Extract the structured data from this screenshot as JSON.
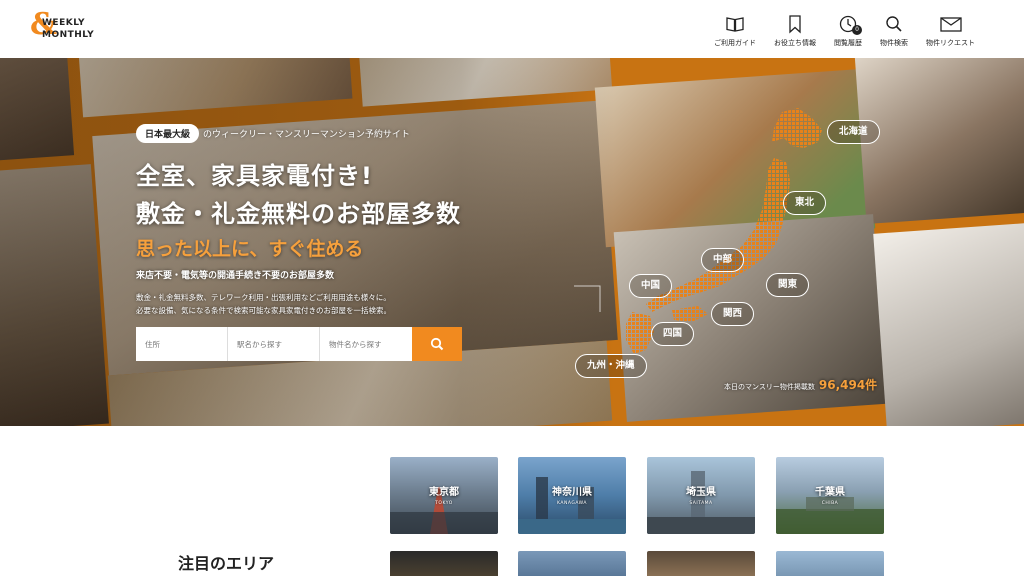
{
  "brand": {
    "logo_symbol": "&",
    "logo_line1": "WEEKLY",
    "logo_line2": "MONTHLY",
    "accent_color": "#f18a1f"
  },
  "nav": {
    "items": [
      {
        "label": "ご利用ガイド",
        "icon": "book-icon"
      },
      {
        "label": "お役立ち情報",
        "icon": "bookmark-icon"
      },
      {
        "label": "閲覧履歴",
        "icon": "clock-icon",
        "badge": "0"
      },
      {
        "label": "物件検索",
        "icon": "search-icon"
      },
      {
        "label": "物件リクエスト",
        "icon": "mail-icon"
      }
    ]
  },
  "hero": {
    "tag": "日本最大級",
    "tag_suffix": "のウィークリー・マンスリーマンション予約サイト",
    "headline_1": "全室、家具家電付き!",
    "headline_2": "敷金・礼金無料のお部屋多数",
    "subheadline": "思った以上に、すぐ住める",
    "feature": "来店不要・電気等の開通手続き不要のお部屋多数",
    "description_1": "敷金・礼金無料多数、テレワーク利用・出張利用などご利用用途も様々に。",
    "description_2": "必要な設備、気になる条件で検索可能な家具家電付きのお部屋を一括検索。",
    "search": {
      "address_placeholder": "住所",
      "station_placeholder": "駅名から探す",
      "property_placeholder": "物件名から探す"
    },
    "regions": [
      "北海道",
      "東北",
      "中部",
      "関東",
      "中国",
      "関西",
      "四国",
      "九州・沖縄"
    ],
    "listing_count_label": "本日のマンスリー物件掲載数",
    "listing_count": "96,494件"
  },
  "areas": {
    "title": "注目のエリア",
    "cards": [
      {
        "name": "東京都",
        "en": "TOKYO"
      },
      {
        "name": "神奈川県",
        "en": "KANAGAWA"
      },
      {
        "name": "埼玉県",
        "en": "SAITAMA"
      },
      {
        "name": "千葉県",
        "en": "CHIBA"
      }
    ]
  }
}
